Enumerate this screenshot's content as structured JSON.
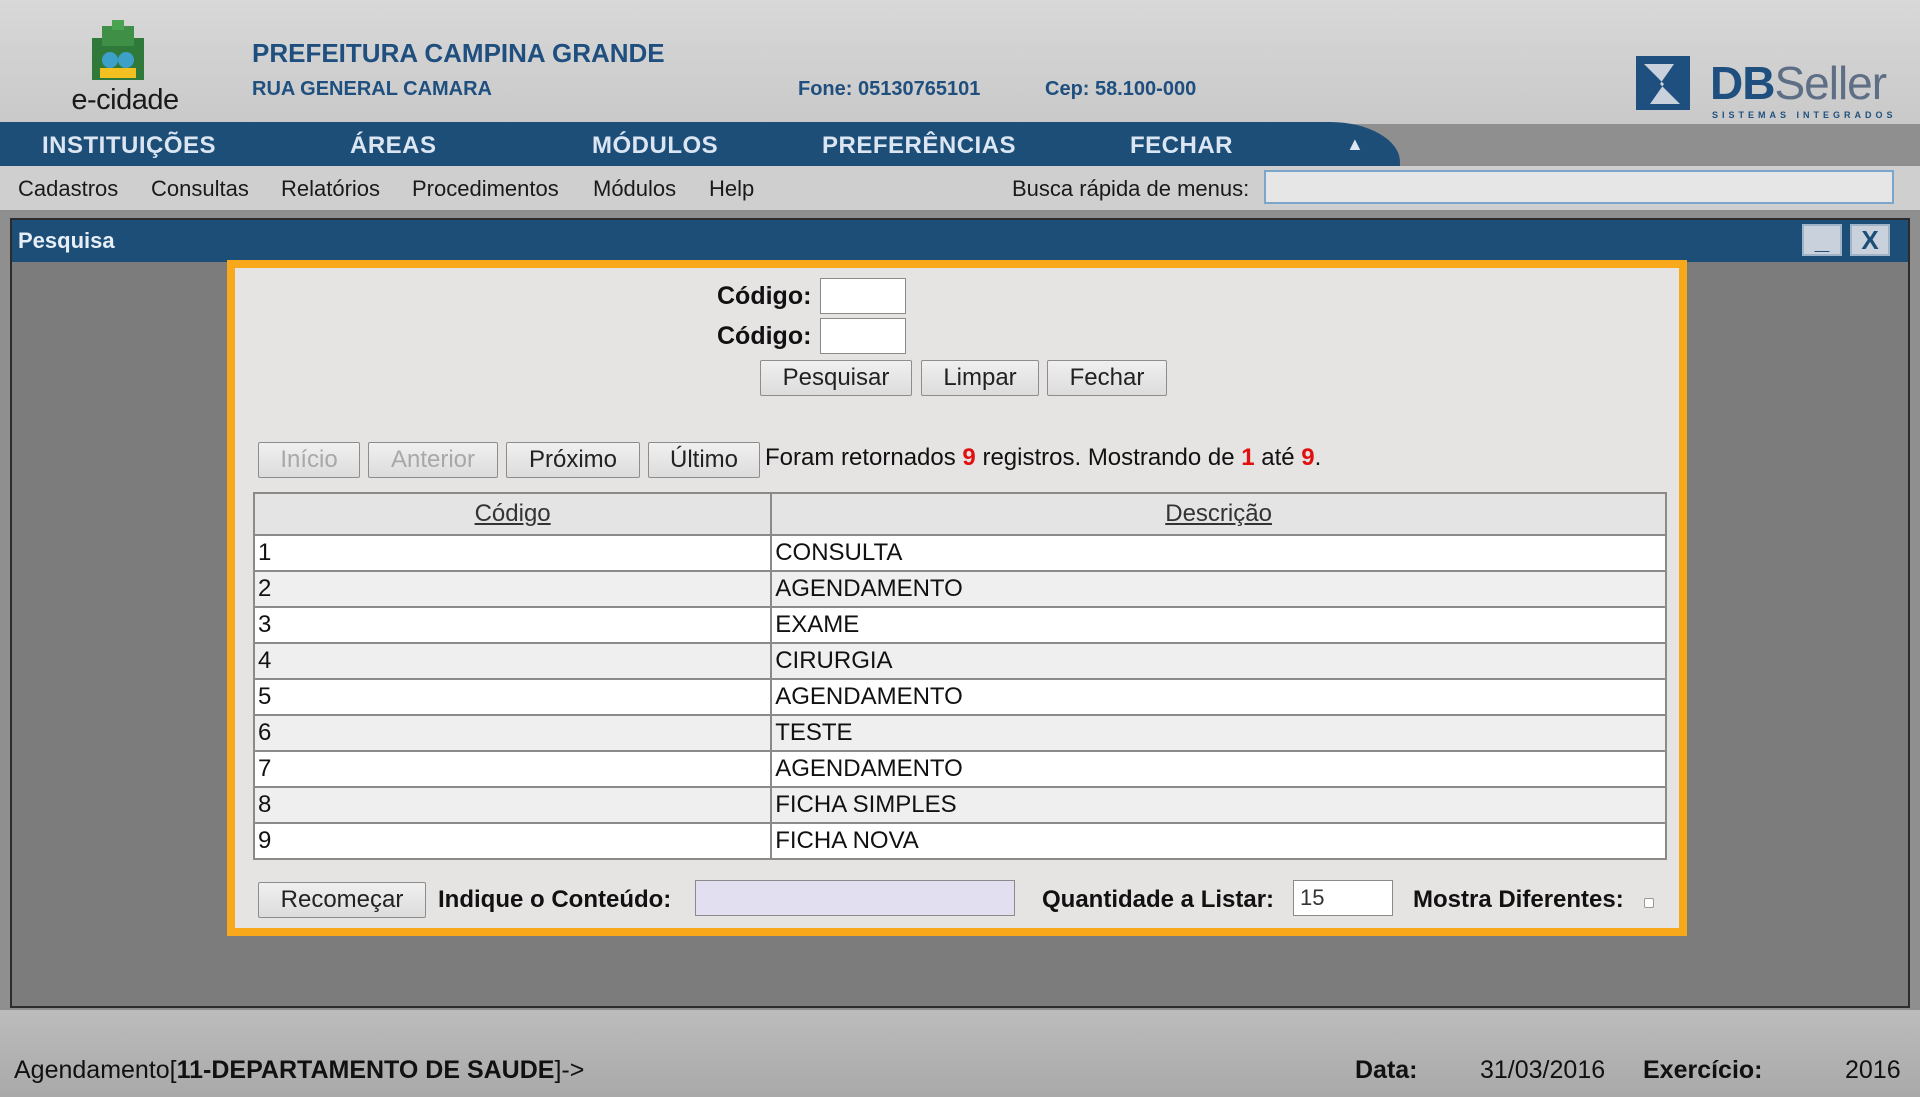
{
  "header": {
    "logo_text": "e-cidade",
    "org_name": "PREFEITURA CAMPINA GRANDE",
    "address": "RUA GENERAL CAMARA",
    "phone": "Fone: 05130765101",
    "cep": "Cep: 58.100-000",
    "brand_bold": "DB",
    "brand_light": "Seller",
    "brand_sub": "SISTEMAS INTEGRADOS"
  },
  "mainnav": {
    "items": [
      "INSTITUIÇÕES",
      "ÁREAS",
      "MÓDULOS",
      "PREFERÊNCIAS",
      "FECHAR"
    ],
    "arrow_icon": "triangle-up-icon"
  },
  "submenu": {
    "items": [
      "Cadastros",
      "Consultas",
      "Relatórios",
      "Procedimentos",
      "Módulos",
      "Help"
    ],
    "search_label": "Busca rápida de menus:",
    "search_value": ""
  },
  "window": {
    "title": "Pesquisa",
    "minimize": "_",
    "close": "X"
  },
  "dialog": {
    "codigo_label_1": "Código:",
    "codigo_label_2": "Código:",
    "buttons": {
      "pesquisar": "Pesquisar",
      "limpar": "Limpar",
      "fechar": "Fechar",
      "inicio": "Início",
      "anterior": "Anterior",
      "proximo": "Próximo",
      "ultimo": "Último",
      "recomecar": "Recomeçar"
    },
    "status": {
      "prefix": "Foram retornados ",
      "total": "9",
      "middle": " registros. Mostrando de ",
      "from": "1",
      "to_word": " até ",
      "to": "9",
      "suffix": "."
    },
    "table": {
      "headers": [
        "Código",
        "Descrição"
      ],
      "rows": [
        [
          "1",
          "CONSULTA"
        ],
        [
          "2",
          "AGENDAMENTO"
        ],
        [
          "3",
          "EXAME"
        ],
        [
          "4",
          "CIRURGIA"
        ],
        [
          "5",
          "AGENDAMENTO"
        ],
        [
          "6",
          "TESTE"
        ],
        [
          "7",
          "AGENDAMENTO"
        ],
        [
          "8",
          "FICHA SIMPLES"
        ],
        [
          "9",
          "FICHA NOVA"
        ]
      ]
    },
    "conteudo_label": "Indique o Conteúdo:",
    "conteudo_value": "",
    "quantidade_label": "Quantidade a Listar:",
    "quantidade_value": "15",
    "mostra_label": "Mostra Diferentes:"
  },
  "footer": {
    "context_prefix": "Agendamento[",
    "context_bold": "11-DEPARTAMENTO DE SAUDE",
    "context_suffix": "]->",
    "data_label": "Data:",
    "data_value": "31/03/2016",
    "exercicio_label": "Exercício:",
    "exercicio_value": "2016"
  },
  "colors": {
    "nav_blue": "#1d4e78",
    "dialog_border": "#f7a91b",
    "highlight_red": "#e01010"
  }
}
